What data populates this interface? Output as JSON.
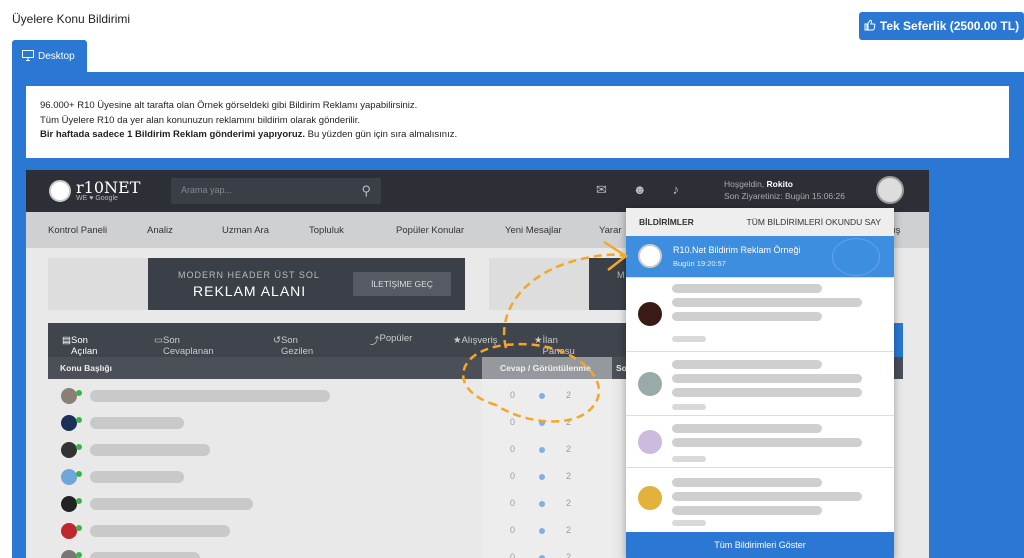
{
  "page": {
    "title": "Üyelere Konu Bildirimi",
    "one_time_button": "Tek Seferlik (2500.00 TL)",
    "tab_label": "Desktop"
  },
  "info": {
    "line1": "96.000+ R10 Üyesine alt tarafta olan Örnek görseldeki gibi Bildirim Reklamı yapabilirsiniz.",
    "line2": "Tüm Üyelere R10 da yer alan konunuzun reklamını bildirim olarak gönderilir.",
    "line3_bold": "Bir haftada sadece 1 Bildirim Reklam gönderimi yapıyoruz.",
    "line3_rest": " Bu yüzden gün için sıra almalısınız."
  },
  "preview": {
    "logo_main": "r10NET",
    "logo_sub": "WE ♥ Google",
    "search_placeholder": "Arama yap...",
    "welcome_prefix": "Hoşgeldin, ",
    "welcome_user": "Rokito",
    "last_visit": "Son Ziyaretiniz: Bugün 15:06:26",
    "nav": [
      "Kontrol Paneli",
      "Analiz",
      "Uzman Ara",
      "Topluluk",
      "Popüler Konular",
      "Yeni Mesajlar",
      "Yarar",
      "ış"
    ],
    "banner_line1": "MODERN HEADER ÜST SOL",
    "banner_line2": "REKLAM ALANI",
    "banner_cta": "İLETİŞİME GEÇ",
    "banner2_text": "M",
    "tabs": [
      "Son Açılan",
      "Son Cevaplanan",
      "Son Gezilen",
      "Popüler",
      "Alışveriş",
      "İlan Panosu"
    ],
    "col_topic": "Konu Başlığı",
    "col_stats": "Cevap / Görüntülenme",
    "col_last": "So",
    "rows": [
      {
        "replies": "0",
        "views": "2"
      },
      {
        "replies": "0",
        "views": "2"
      },
      {
        "replies": "0",
        "views": "2"
      },
      {
        "replies": "0",
        "views": "2"
      },
      {
        "replies": "0",
        "views": "2"
      },
      {
        "replies": "0",
        "views": "2"
      },
      {
        "replies": "0",
        "views": "2"
      }
    ]
  },
  "notifications": {
    "header": "BİLDİRİMLER",
    "mark_all": "TÜM BİLDİRİMLERİ OKUNDU SAY",
    "highlight_title": "R10.Net Bildirim Reklam Örneği",
    "highlight_time": "Bugün 19:20:57",
    "show_all": "Tüm Bildirimleri Göster"
  },
  "colors": {
    "accent": "#2a78d4",
    "highlight": "#3e8ee0",
    "arrow": "#f5a623",
    "online": "#3bb34a"
  }
}
